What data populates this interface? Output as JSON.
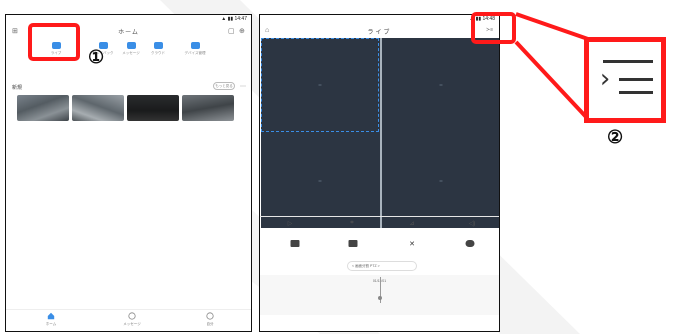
{
  "colors": {
    "highlight": "#ff1a1a",
    "accent": "#3a8ee6",
    "video_bg": "#2c3542"
  },
  "phone1": {
    "header_title": "ホーム",
    "section_label": "新規",
    "more_pill": "もっと見る",
    "icons": [
      "grid-icon",
      "tablet-icon",
      "add-icon"
    ],
    "quick_items": [
      {
        "label": "ライブ",
        "icon": "camera-icon"
      },
      {
        "label": "プレイバック",
        "icon": "playback-icon"
      },
      {
        "label": "メッセージ",
        "icon": "message-icon"
      },
      {
        "label": "クラウド",
        "icon": "cloud-icon"
      },
      {
        "label": "デバイス管理",
        "icon": "device-icon"
      }
    ],
    "tabs": [
      "ホーム",
      "メッセージ",
      "自分"
    ],
    "callout_number": "①"
  },
  "phone2": {
    "header_title": "ライブ",
    "timeline_date": "01/11/01",
    "ptz_label": "< 画面分割  PTZ  >",
    "controls_row1": [
      "play-icon",
      "layout-icon",
      "snapshot-icon",
      "volume-icon"
    ],
    "controls_row2": [
      "record-icon",
      "capture-icon",
      "ptz-icon",
      "more-icon"
    ]
  },
  "zoom": {
    "callout_number": "②"
  }
}
